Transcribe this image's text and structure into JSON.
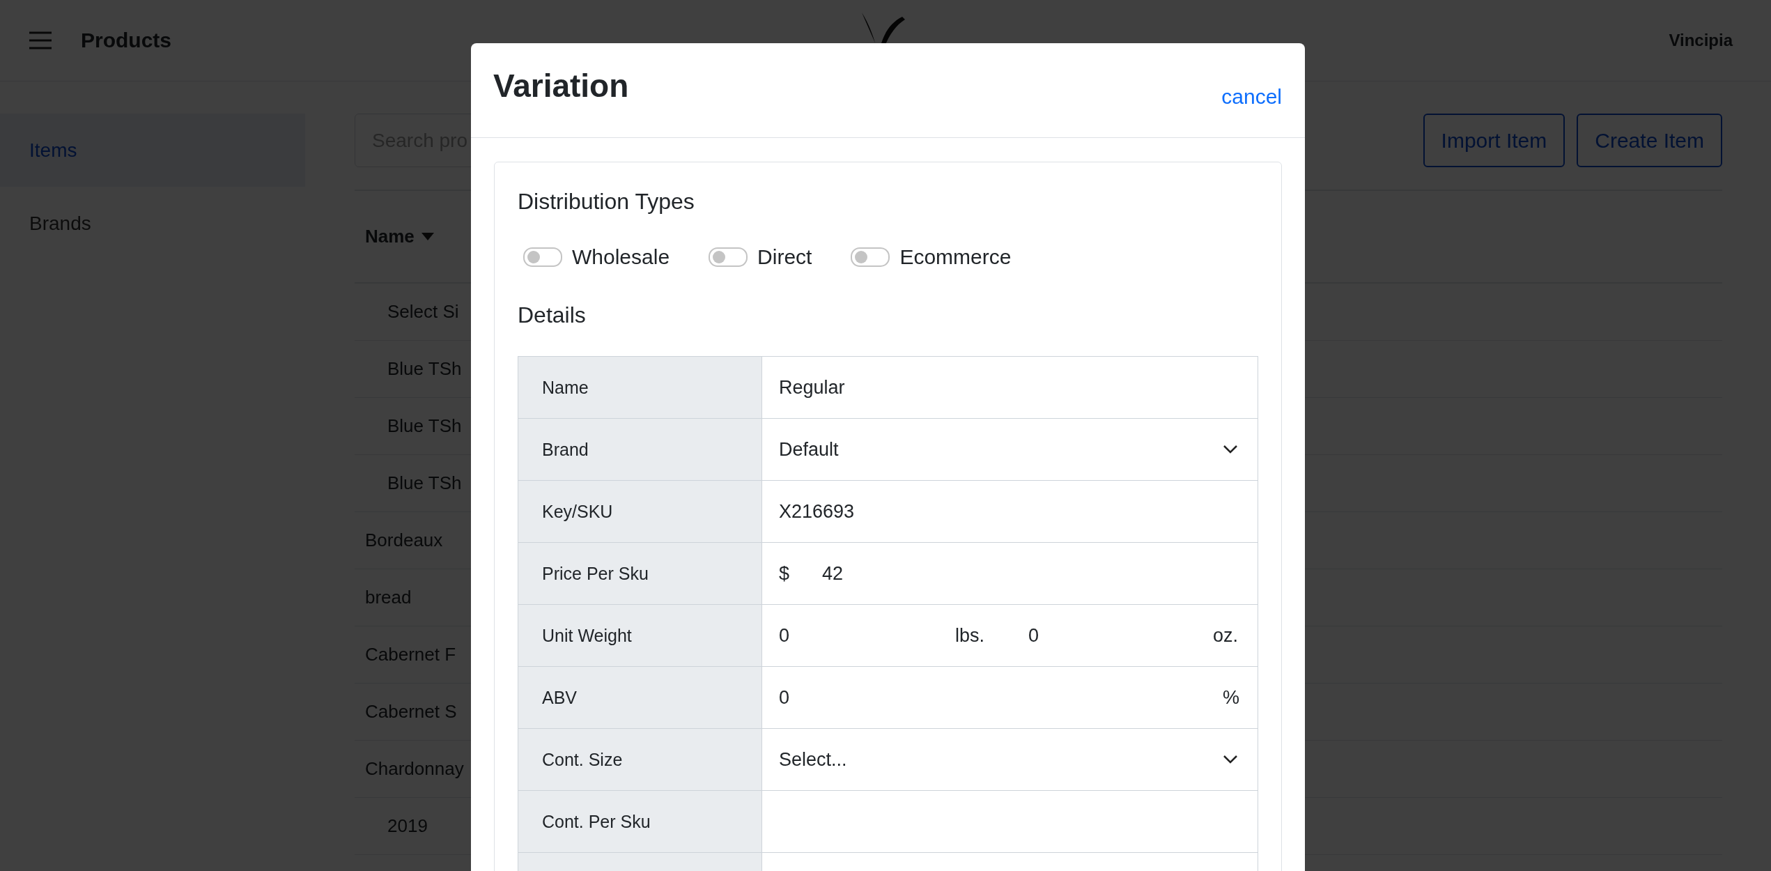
{
  "header": {
    "title": "Products",
    "account": "Vincipia"
  },
  "sidebar": {
    "items": [
      {
        "label": "Items",
        "selected": true
      },
      {
        "label": "Brands",
        "selected": false
      }
    ]
  },
  "toolbar": {
    "search": {
      "placeholder": "Search pro"
    },
    "buttons": [
      "Import Item",
      "Create Item"
    ]
  },
  "table": {
    "columns": [
      {
        "label": "Name"
      }
    ],
    "rows": [
      {
        "children": [
          {
            "name": "Select Si"
          },
          {
            "name": "Blue TSh"
          },
          {
            "name": "Blue TSh"
          },
          {
            "name": "Blue TSh"
          }
        ]
      },
      {
        "name": "Bordeaux"
      },
      {
        "name": "bread"
      },
      {
        "name": "Cabernet F"
      },
      {
        "name": "Cabernet S"
      },
      {
        "name": "Chardonnay",
        "children": [
          {
            "name": "2019"
          }
        ]
      }
    ]
  },
  "modal": {
    "title": "Variation",
    "cancel": "cancel",
    "distribution": {
      "title": "Distribution Types",
      "options": [
        {
          "label": "Wholesale",
          "on": false
        },
        {
          "label": "Direct",
          "on": false
        },
        {
          "label": "Ecommerce",
          "on": false
        }
      ]
    },
    "details": {
      "title": "Details",
      "rows": [
        {
          "kind": "text",
          "label": "Name",
          "value": "Regular"
        },
        {
          "kind": "select",
          "label": "Brand",
          "value": "Default"
        },
        {
          "kind": "text",
          "label": "Key/SKU",
          "value": "X216693"
        },
        {
          "kind": "price",
          "label": "Price Per Sku",
          "prefix": "$",
          "value": "42"
        },
        {
          "kind": "weight",
          "label": "Unit Weight",
          "value": "0",
          "unit": "lbs.",
          "value2": "0",
          "unit2": "oz."
        },
        {
          "kind": "percent",
          "label": "ABV",
          "value": "0",
          "unit": "%"
        },
        {
          "kind": "select",
          "label": "Cont. Size",
          "value": "Select..."
        },
        {
          "kind": "text",
          "label": "Cont. Per Sku"
        },
        {
          "kind": "text"
        }
      ]
    }
  }
}
